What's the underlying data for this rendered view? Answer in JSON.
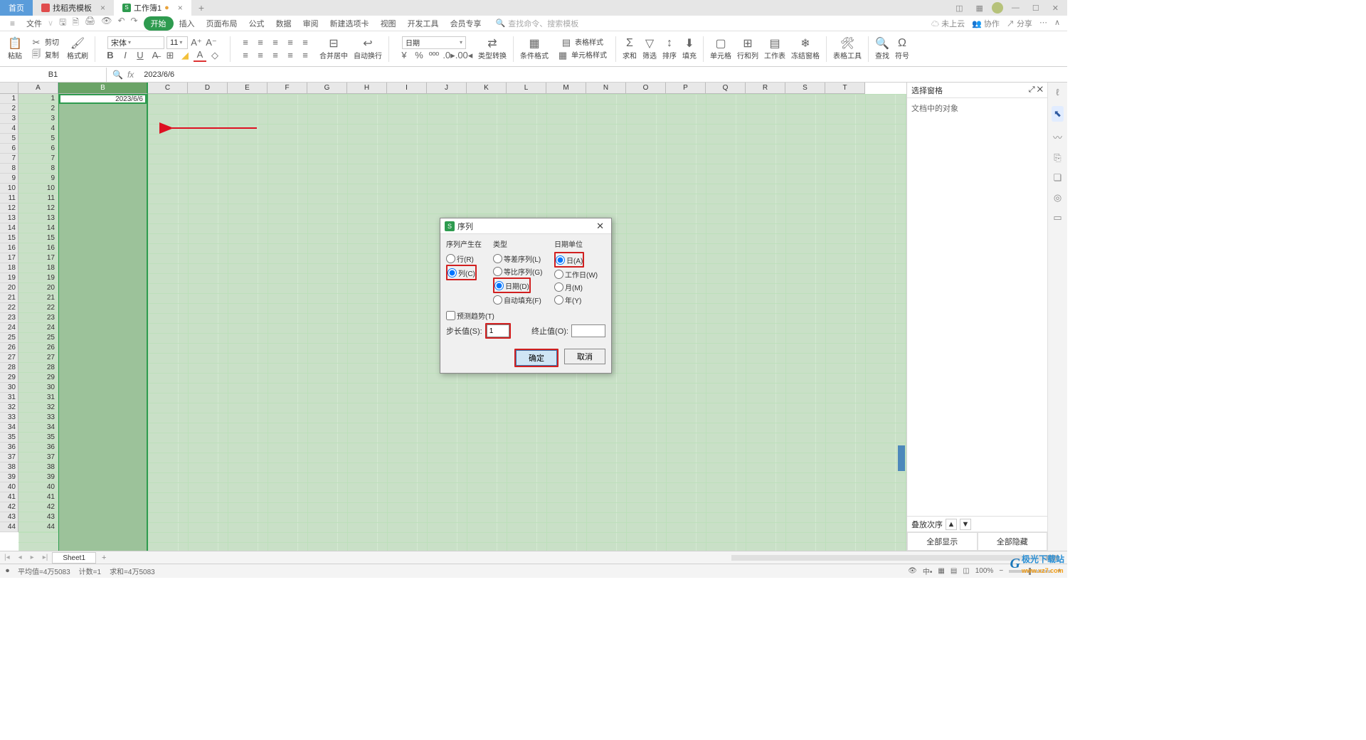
{
  "tabs": {
    "home": "首页",
    "tpl": "找稻壳模板",
    "wb": "工作簿1"
  },
  "menus": {
    "file": "文件",
    "start": "开始",
    "insert": "插入",
    "layout": "页面布局",
    "formula": "公式",
    "data": "数据",
    "review": "审阅",
    "newtab": "新建选项卡",
    "view": "视图",
    "dev": "开发工具",
    "member": "会员专享"
  },
  "searchPH": "查找命令、搜索模板",
  "topRight": {
    "cloud": "未上云",
    "collab": "协作",
    "share": "分享"
  },
  "ribbon": {
    "paste": "粘贴",
    "cut": "剪切",
    "copy": "复制",
    "format": "格式刷",
    "fontName": "宋体",
    "fontSize": "11",
    "merge": "合并居中",
    "wrap": "自动换行",
    "numfmt": "日期",
    "typeConv": "类型转换",
    "cond": "条件格式",
    "tablestyle": "表格样式",
    "cellstyle": "单元格样式",
    "sum": "求和",
    "filter": "筛选",
    "sort": "排序",
    "fill": "填充",
    "cell": "单元格",
    "rowcol": "行和列",
    "sheet": "工作表",
    "freeze": "冻结窗格",
    "tabletool": "表格工具",
    "find": "查找",
    "symbol": "符号"
  },
  "cellref": "B1",
  "cellval": "2023/6/6",
  "panel": {
    "title": "选择窗格",
    "obj": "文档中的对象",
    "stack": "叠放次序",
    "showAll": "全部显示",
    "hideAll": "全部隐藏"
  },
  "sheet": "Sheet1",
  "cols": [
    "A",
    "B",
    "C",
    "D",
    "E",
    "F",
    "G",
    "H",
    "I",
    "J",
    "K",
    "L",
    "M",
    "N",
    "O",
    "P",
    "Q",
    "R",
    "S",
    "T"
  ],
  "status": {
    "avg": "平均值=4万5083",
    "count": "计数=1",
    "sum": "求和=4万5083",
    "zoom": "100%"
  },
  "dialog": {
    "title": "序列",
    "g1": "序列产生在",
    "r1a": "行(R)",
    "r1b": "列(C)",
    "g2": "类型",
    "r2a": "等差序列(L)",
    "r2b": "等比序列(G)",
    "r2c": "日期(D)",
    "r2d": "自动填充(F)",
    "g3": "日期单位",
    "r3a": "日(A)",
    "r3b": "工作日(W)",
    "r3c": "月(M)",
    "r3d": "年(Y)",
    "trend": "预测趋势(T)",
    "step": "步长值(S):",
    "stepv": "1",
    "end": "终止值(O):",
    "ok": "确定",
    "cancel": "取消"
  },
  "watermark": "极光下载站",
  "watermark2": "www.xz7.com"
}
